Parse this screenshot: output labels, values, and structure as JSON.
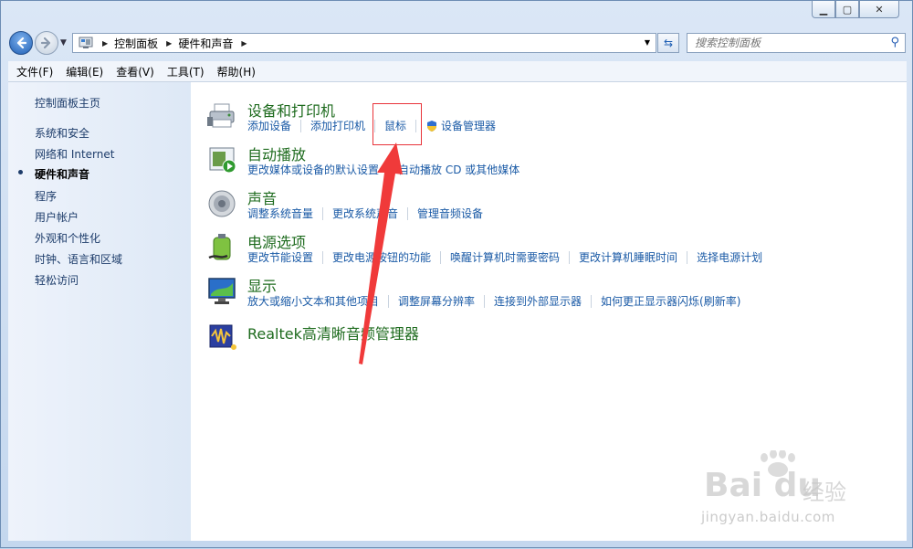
{
  "caption": {
    "minimize": "▁",
    "maximize": "▢",
    "close": "✕"
  },
  "address": {
    "segments": [
      "控制面板",
      "硬件和声音"
    ]
  },
  "search": {
    "placeholder": "搜索控制面板"
  },
  "menu": [
    "文件(F)",
    "编辑(E)",
    "查看(V)",
    "工具(T)",
    "帮助(H)"
  ],
  "sidebar": {
    "items": [
      "控制面板主页",
      "系统和安全",
      "网络和 Internet",
      "硬件和声音",
      "程序",
      "用户帐户",
      "外观和个性化",
      "时钟、语言和区域",
      "轻松访问"
    ],
    "active_index": 3
  },
  "categories": [
    {
      "title": "设备和打印机",
      "icon": "printer-icon",
      "links": [
        "添加设备",
        "添加打印机",
        "鼠标",
        "设备管理器"
      ]
    },
    {
      "title": "自动播放",
      "icon": "autoplay-icon",
      "links": [
        "更改媒体或设备的默认设置",
        "自动播放 CD 或其他媒体"
      ]
    },
    {
      "title": "声音",
      "icon": "speaker-icon",
      "links": [
        "调整系统音量",
        "更改系统声音",
        "管理音频设备"
      ]
    },
    {
      "title": "电源选项",
      "icon": "battery-icon",
      "links": [
        "更改节能设置",
        "更改电源按钮的功能",
        "唤醒计算机时需要密码",
        "更改计算机睡眠时间",
        "选择电源计划"
      ]
    },
    {
      "title": "显示",
      "icon": "monitor-icon",
      "links": [
        "放大或缩小文本和其他项目",
        "调整屏幕分辨率",
        "连接到外部显示器",
        "如何更正显示器闪烁(刷新率)"
      ]
    },
    {
      "title": "Realtek高清晰音频管理器",
      "icon": "realtek-audio-icon",
      "links": []
    }
  ],
  "watermark": {
    "logo": "Bai  du",
    "jingyan": "经验",
    "url": "jingyan.baidu.com"
  },
  "colors": {
    "link": "#1a5aa6",
    "category_title": "#1e6b1e",
    "highlight": "#e8333a"
  }
}
